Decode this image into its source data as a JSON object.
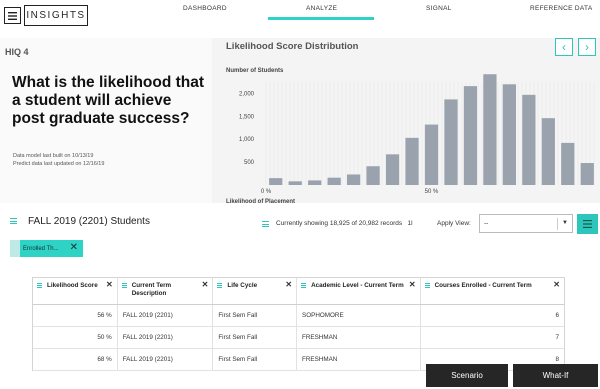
{
  "app": {
    "title": "INSIGHTS",
    "menu_icon": "hamburger-icon"
  },
  "nav": {
    "tabs": [
      {
        "label": "DASHBOARD"
      },
      {
        "label": "ANALYZE"
      },
      {
        "label": "SIGNAL"
      },
      {
        "label": "REFERENCE DATA"
      }
    ],
    "active": "ANALYZE",
    "accent_color": "#2ed3c6"
  },
  "hero": {
    "label": "HIQ 4",
    "question": "What is the likelihood that a student will achieve post graduate success?",
    "model_built": "Data model last built on 10/13/19",
    "predict_updated": "Predict data last updated on 12/16/19"
  },
  "chart_panel": {
    "title": "Likelihood Score Distribution",
    "prev_icon": "chevron-left-icon",
    "next_icon": "chevron-right-icon"
  },
  "chart_data": {
    "type": "bar",
    "ylabel": "Number of Students",
    "xlabel": "Likelihood of Placement",
    "yticks": [
      "2,000",
      "1,500",
      "1,000",
      "500"
    ],
    "ytick_values": [
      2000,
      1500,
      1000,
      500
    ],
    "xticks": [
      "0 %",
      "50 %"
    ],
    "xtick_positions": [
      0,
      50
    ],
    "ylim": [
      0,
      2250
    ],
    "xlim": [
      0,
      100
    ],
    "bar_color": "#9aa3ad",
    "values": [
      150,
      80,
      100,
      160,
      230,
      410,
      670,
      1030,
      1320,
      1870,
      2160,
      2420,
      2200,
      1970,
      1460,
      920,
      480
    ]
  },
  "students": {
    "title": "FALL 2019 (2201) Students",
    "showing": "Currently showing 18,925 of 20,982 records",
    "showing_suffix": "1l",
    "apply_label": "Apply View:",
    "apply_value": "--"
  },
  "filter_chip": {
    "label": "Enrolled Th..."
  },
  "table": {
    "columns": [
      "Likelihood Score",
      "Current Term Description",
      "Life Cycle",
      "Academic Level - Current Term",
      "Courses Enrolled - Current Term"
    ],
    "rows": [
      [
        "56 %",
        "FALL 2019 (2201)",
        "First Sem Fall",
        "SOPHOMORE",
        "6"
      ],
      [
        "50 %",
        "FALL 2019 (2201)",
        "First Sem Fall",
        "FRESHMAN",
        "7"
      ],
      [
        "68 %",
        "FALL 2019 (2201)",
        "First Sem Fall",
        "FRESHMAN",
        "8"
      ]
    ]
  },
  "actions": {
    "scenario": "Scenario",
    "whatif": "What-If"
  }
}
